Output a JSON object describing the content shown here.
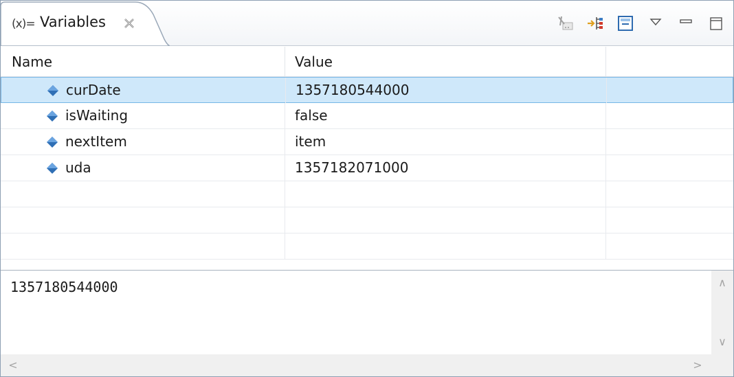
{
  "tab": {
    "icon_text": "(x)=",
    "label": "Variables"
  },
  "toolbar": {
    "buttons": [
      {
        "icon": "show-type-names-icon"
      },
      {
        "icon": "show-logical-structure-icon"
      },
      {
        "icon": "collapse-all-icon"
      },
      {
        "icon": "view-menu-icon"
      },
      {
        "icon": "minimize-icon"
      },
      {
        "icon": "maximize-icon"
      }
    ]
  },
  "table": {
    "columns": [
      "Name",
      "Value"
    ],
    "rows": [
      {
        "name": "curDate",
        "value": "1357180544000",
        "selected": true
      },
      {
        "name": "isWaiting",
        "value": "false"
      },
      {
        "name": "nextItem",
        "value": "item"
      },
      {
        "name": "uda",
        "value": "1357182071000"
      }
    ]
  },
  "detail": {
    "text": "1357180544000"
  },
  "colors": {
    "selection_bg": "#cfe8fa",
    "selection_border": "#76b6e5",
    "variable_icon": "#2f6fb5"
  }
}
